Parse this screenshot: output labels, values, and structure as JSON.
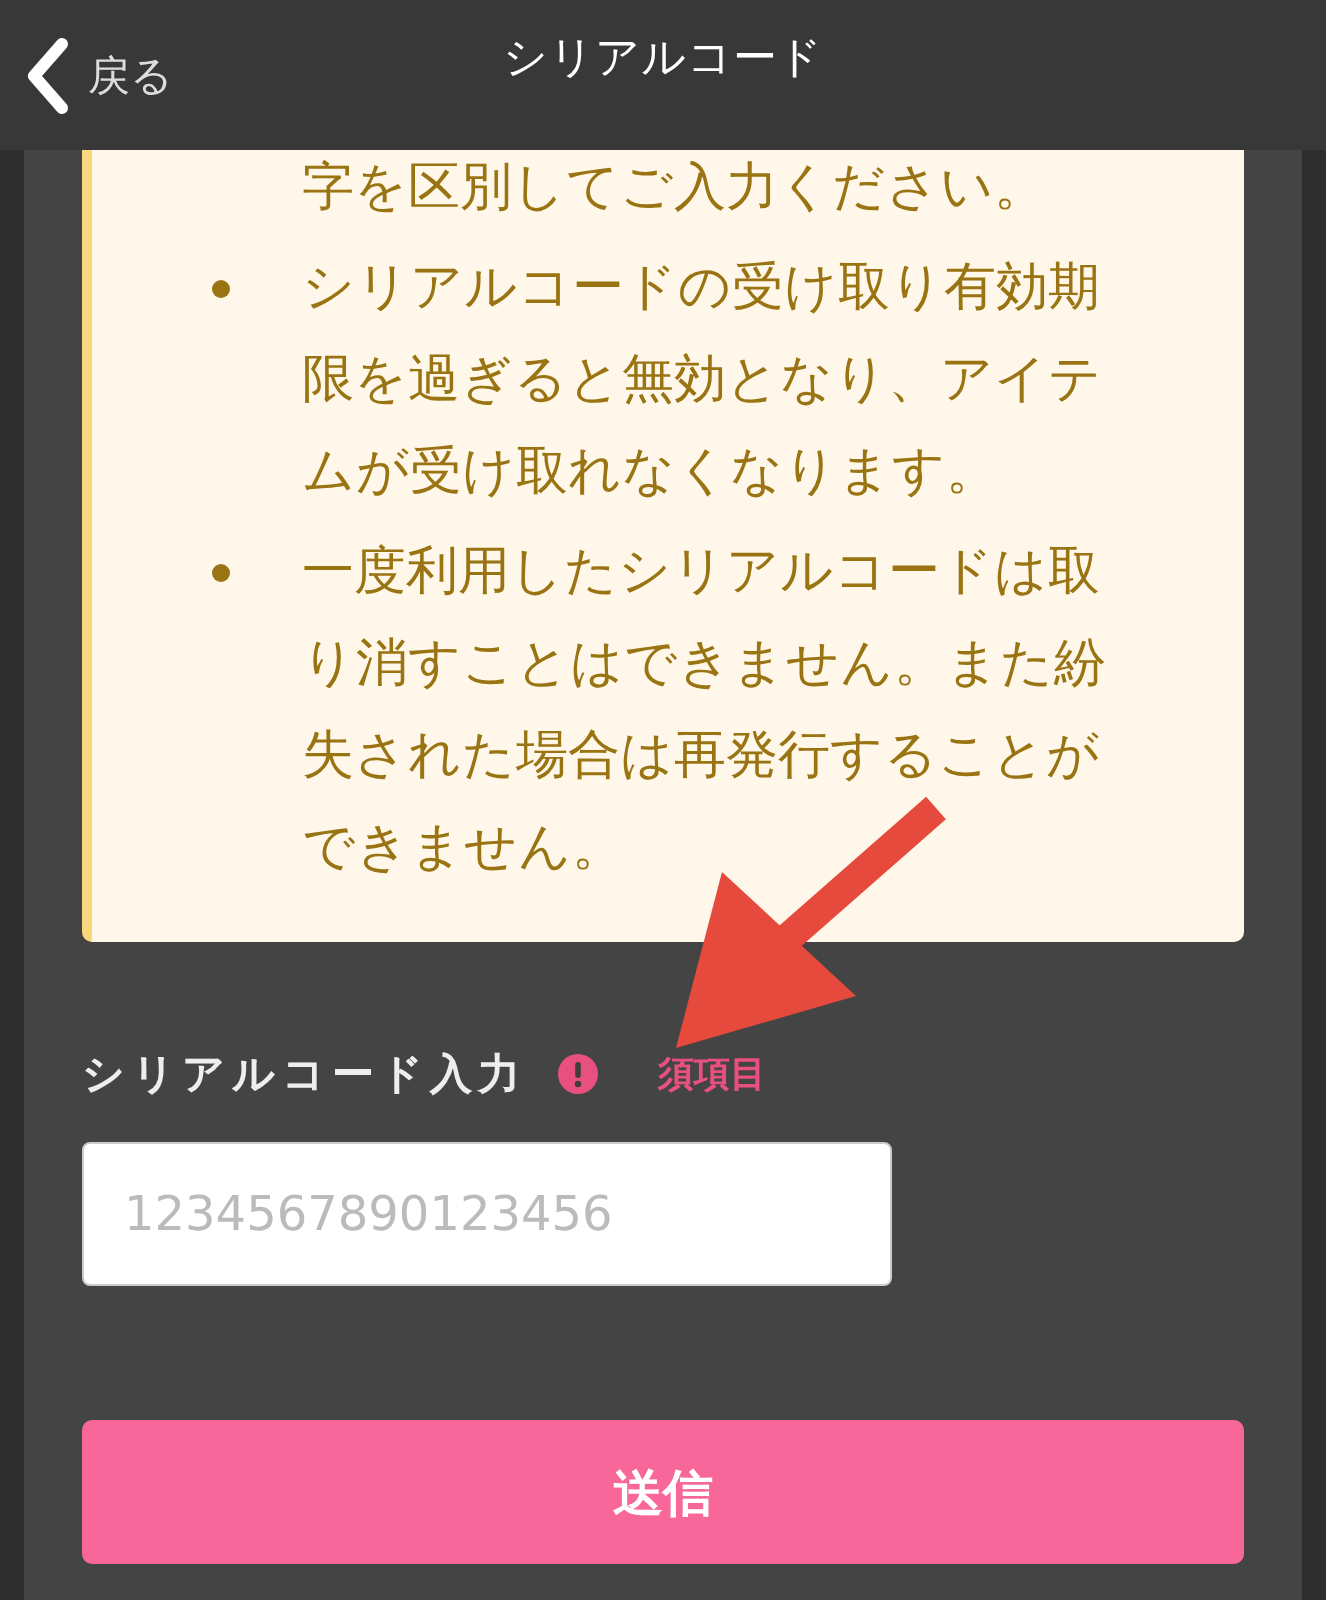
{
  "header": {
    "back_label": "戻る",
    "title": "シリアルコード"
  },
  "notes": [
    {
      "text": "字を区別してご入力ください。",
      "bulleted": false
    },
    {
      "text": "シリアルコードの受け取り有効期限を過ぎると無効となり、アイテムが受け取れなくなります。",
      "bulleted": true
    },
    {
      "text": "一度利用したシリアルコードは取り消すことはできません。また紛失された場合は再発行することができません。",
      "bulleted": true
    }
  ],
  "form": {
    "label": "シリアルコード入力",
    "required_label": "須項目",
    "placeholder": "1234567890123456"
  },
  "submit_button": "送信"
}
